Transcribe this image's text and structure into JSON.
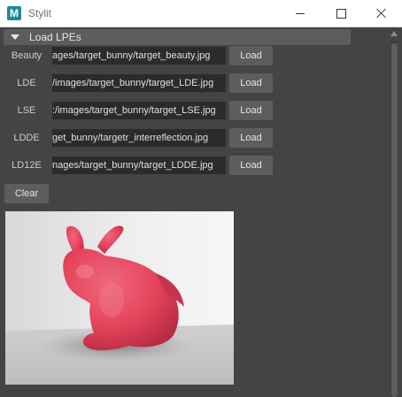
{
  "window": {
    "title": "Stylit",
    "icon_letter": "M",
    "icon": "maya-app-icon",
    "controls": [
      "minimize-icon",
      "maximize-icon",
      "close-icon"
    ]
  },
  "section": {
    "title": "Load LPEs",
    "expanded": true
  },
  "lpes": [
    {
      "label": "Beauty",
      "path": "ages/target_bunny/target_beauty.jpg",
      "button": "Load"
    },
    {
      "label": "LDE",
      "path": "/images/target_bunny/target_LDE.jpg",
      "button": "Load"
    },
    {
      "label": "LSE",
      "path": ":/images/target_bunny/target_LSE.jpg",
      "button": "Load"
    },
    {
      "label": "LDDE",
      "path": "get_bunny/targetr_interreflection.jpg",
      "button": "Load"
    },
    {
      "label": "LD12E",
      "path": "nages/target_bunny/target_LDDE.jpg",
      "button": "Load"
    }
  ],
  "clear_button": "Clear",
  "preview": {
    "subject": "pink bunny render",
    "colors": {
      "bunny": "#e8485f",
      "floor": "#c9c9c9",
      "wall": "#ededed"
    }
  },
  "theme": {
    "panel_bg": "#444444",
    "button_bg": "#5d5d5d",
    "field_bg": "#2b2b2b",
    "text": "#e6e6e6"
  }
}
